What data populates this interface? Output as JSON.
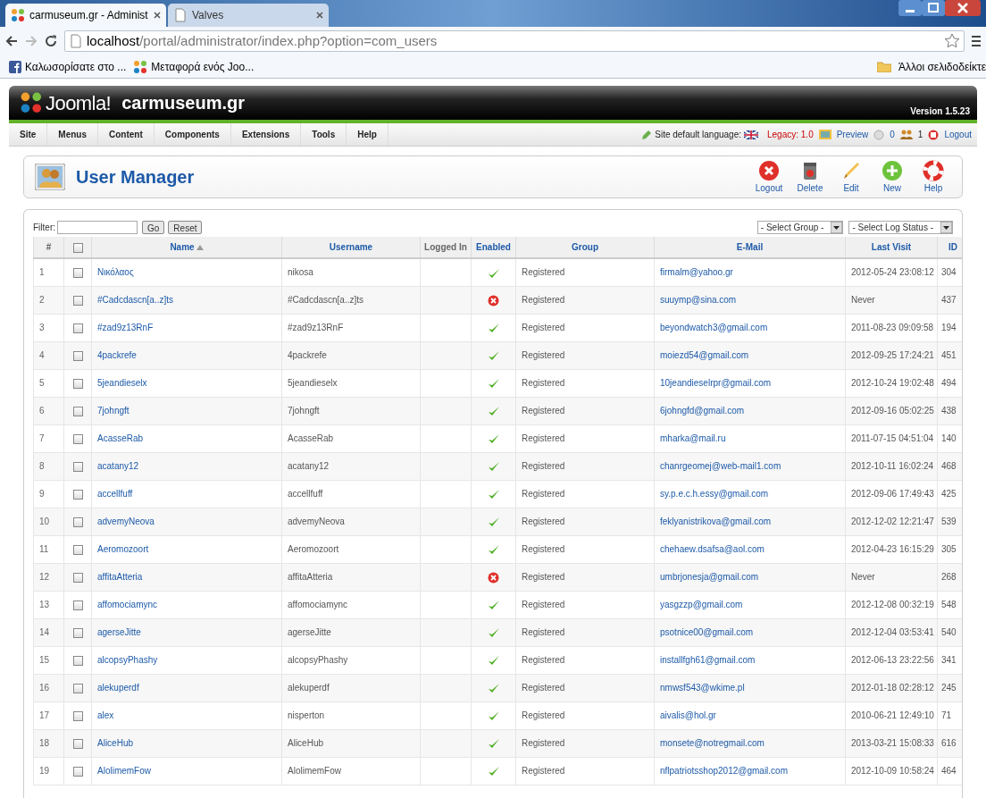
{
  "browser": {
    "tabs": [
      {
        "title": "carmuseum.gr - Administ",
        "selected": true,
        "kind": "joomla"
      },
      {
        "title": "Valves",
        "selected": false,
        "kind": "page"
      }
    ],
    "url_host": "localhost",
    "url_path": "/portal/administrator/index.php?option=com_users",
    "bookmarks": [
      {
        "label": "Καλωσορίσατε στο ...",
        "kind": "facebook"
      },
      {
        "label": "Μεταφορά ενός Joo...",
        "kind": "joomla"
      }
    ],
    "other_bookmarks": "Άλλοι σελιδοδείκτε"
  },
  "header": {
    "logo_text": "Joomla!",
    "site_name": "carmuseum.gr",
    "version": "Version 1.5.23"
  },
  "menu": [
    "Site",
    "Menus",
    "Content",
    "Components",
    "Extensions",
    "Tools",
    "Help"
  ],
  "status": {
    "language_label": "Site default language:",
    "legacy": "Legacy: 1.0",
    "preview": "Preview",
    "messages": "0",
    "users_online": "1",
    "logout": "Logout"
  },
  "toolbar": {
    "title": "User Manager",
    "buttons": [
      {
        "label": "Logout",
        "kind": "logout"
      },
      {
        "label": "Delete",
        "kind": "delete"
      },
      {
        "label": "Edit",
        "kind": "edit"
      },
      {
        "label": "New",
        "kind": "new"
      },
      {
        "label": "Help",
        "kind": "help"
      }
    ]
  },
  "filter": {
    "label": "Filter:",
    "go": "Go",
    "reset": "Reset",
    "group_select": "- Select Group -",
    "log_select": "- Select Log Status -"
  },
  "table": {
    "columns": [
      "#",
      "Name",
      "Username",
      "Logged In",
      "Enabled",
      "Group",
      "E-Mail",
      "Last Visit",
      "ID"
    ],
    "all_checked": false,
    "rows": [
      {
        "num": "1",
        "checked": false,
        "name": "Νικόλαος",
        "username": "nikosa",
        "enabled": true,
        "group": "Registered",
        "email": "firmalm@yahoo.gr",
        "last_visit": "2012-05-24 23:08:12",
        "id": "304"
      },
      {
        "num": "2",
        "checked": false,
        "name": "#Cadcdascn[a..z]ts",
        "username": "#Cadcdascn[a..z]ts",
        "enabled": false,
        "group": "Registered",
        "email": "suuymp@sina.com",
        "last_visit": "Never",
        "id": "437"
      },
      {
        "num": "3",
        "checked": false,
        "name": "#zad9z13RnF",
        "username": "#zad9z13RnF",
        "enabled": true,
        "group": "Registered",
        "email": "beyondwatch3@gmail.com",
        "last_visit": "2011-08-23 09:09:58",
        "id": "194"
      },
      {
        "num": "4",
        "checked": false,
        "name": "4packrefe",
        "username": "4packrefe",
        "enabled": true,
        "group": "Registered",
        "email": "moiezd54@gmail.com",
        "last_visit": "2012-09-25 17:24:21",
        "id": "451"
      },
      {
        "num": "5",
        "checked": false,
        "name": "5jeandieselx",
        "username": "5jeandieselx",
        "enabled": true,
        "group": "Registered",
        "email": "10jeandieselrpr@gmail.com",
        "last_visit": "2012-10-24 19:02:48",
        "id": "494"
      },
      {
        "num": "6",
        "checked": false,
        "name": "7johngft",
        "username": "7johngft",
        "enabled": true,
        "group": "Registered",
        "email": "6johngfd@gmail.com",
        "last_visit": "2012-09-16 05:02:25",
        "id": "438"
      },
      {
        "num": "7",
        "checked": false,
        "name": "AcasseRab",
        "username": "AcasseRab",
        "enabled": true,
        "group": "Registered",
        "email": "mharka@mail.ru",
        "last_visit": "2011-07-15 04:51:04",
        "id": "140"
      },
      {
        "num": "8",
        "checked": false,
        "name": "acatany12",
        "username": "acatany12",
        "enabled": true,
        "group": "Registered",
        "email": "chanrgeomej@web-mail1.com",
        "last_visit": "2012-10-11 16:02:24",
        "id": "468"
      },
      {
        "num": "9",
        "checked": false,
        "name": "accellfuff",
        "username": "accellfuff",
        "enabled": true,
        "group": "Registered",
        "email": "sy.p.e.c.h.essy@gmail.com",
        "last_visit": "2012-09-06 17:49:43",
        "id": "425"
      },
      {
        "num": "10",
        "checked": false,
        "name": "advemyNeova",
        "username": "advemyNeova",
        "enabled": true,
        "group": "Registered",
        "email": "feklyanistrikova@gmail.com",
        "last_visit": "2012-12-02 12:21:47",
        "id": "539"
      },
      {
        "num": "11",
        "checked": false,
        "name": "Aeromozoort",
        "username": "Aeromozoort",
        "enabled": true,
        "group": "Registered",
        "email": "chehaew.dsafsa@aol.com",
        "last_visit": "2012-04-23 16:15:29",
        "id": "305"
      },
      {
        "num": "12",
        "checked": false,
        "name": "affitaAtteria",
        "username": "affitaAtteria",
        "enabled": false,
        "group": "Registered",
        "email": "umbrjonesja@gmail.com",
        "last_visit": "Never",
        "id": "268"
      },
      {
        "num": "13",
        "checked": false,
        "name": "affomociamync",
        "username": "affomociamync",
        "enabled": true,
        "group": "Registered",
        "email": "yasgzzp@gmail.com",
        "last_visit": "2012-12-08 00:32:19",
        "id": "548"
      },
      {
        "num": "14",
        "checked": false,
        "name": "agerseJitte",
        "username": "agerseJitte",
        "enabled": true,
        "group": "Registered",
        "email": "psotnice00@gmail.com",
        "last_visit": "2012-12-04 03:53:41",
        "id": "540"
      },
      {
        "num": "15",
        "checked": false,
        "name": "alcopsyPhashy",
        "username": "alcopsyPhashy",
        "enabled": true,
        "group": "Registered",
        "email": "installfgh61@gmail.com",
        "last_visit": "2012-06-13 23:22:56",
        "id": "341"
      },
      {
        "num": "16",
        "checked": false,
        "name": "alekuperdf",
        "username": "alekuperdf",
        "enabled": true,
        "group": "Registered",
        "email": "nmwsf543@wkime.pl",
        "last_visit": "2012-01-18 02:28:12",
        "id": "245"
      },
      {
        "num": "17",
        "checked": false,
        "name": "alex",
        "username": "nisperton",
        "enabled": true,
        "group": "Registered",
        "email": "aivalis@hol.gr",
        "last_visit": "2010-06-21 12:49:10",
        "id": "71"
      },
      {
        "num": "18",
        "checked": false,
        "name": "AliceHub",
        "username": "AliceHub",
        "enabled": true,
        "group": "Registered",
        "email": "monsete@notregmail.com",
        "last_visit": "2013-03-21 15:08:33",
        "id": "616"
      },
      {
        "num": "19",
        "checked": false,
        "name": "AlolimemFow",
        "username": "AlolimemFow",
        "enabled": true,
        "group": "Registered",
        "email": "nflpatriotsshop2012@gmail.com",
        "last_visit": "2012-10-09 10:58:24",
        "id": "464"
      }
    ]
  }
}
